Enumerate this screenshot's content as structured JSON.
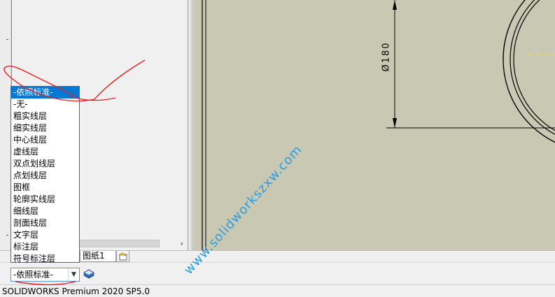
{
  "sheet_tab": {
    "label": "图纸1"
  },
  "layer_control": {
    "selected_value": "-依照标准-",
    "options": [
      "-依照标准-",
      "-无-",
      "粗实线层",
      "细实线层",
      "中心线层",
      "虚线层",
      "双点划线层",
      "点划线层",
      "图框",
      "轮廓实线层",
      "细线层",
      "剖面线层",
      "文字层",
      "标注层",
      "符号标注层"
    ]
  },
  "drawing": {
    "dimension_text": "Ø180"
  },
  "status_bar": {
    "text": "SOLIDWORKS Premium 2020 SP5.0"
  },
  "watermark": {
    "text": "www.solidworkszxw.com"
  },
  "icons": {
    "scroll_right": "›",
    "dropdown_arrow": "▼",
    "add_sheet": "add-sheet-icon",
    "layer_properties": "layer-properties-icon"
  },
  "colors": {
    "canvas_bg": "#c9c9b3",
    "selection": "#0078d7",
    "annotation": "#e02424",
    "watermark": "#2a9de0"
  }
}
